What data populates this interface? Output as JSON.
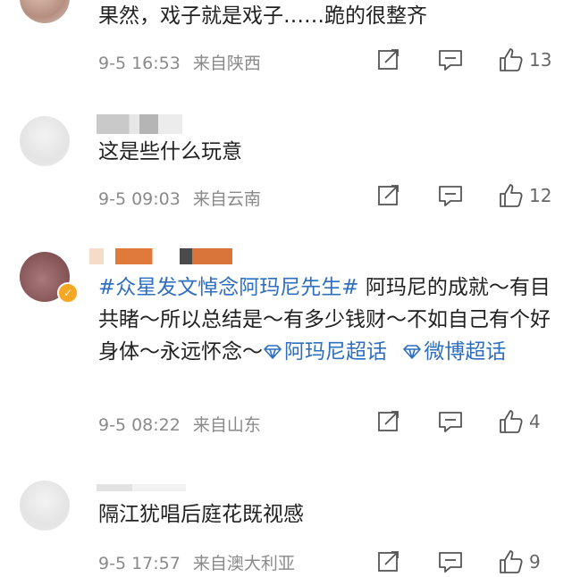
{
  "comments": [
    {
      "text": "果然，戏子就是戏子……跪的很整齐",
      "date": "9-5 16:53",
      "location": "来自陕西",
      "likes": "13"
    },
    {
      "text": "这是些什么玩意",
      "date": "9-5 09:03",
      "location": "来自云南",
      "likes": "12"
    },
    {
      "tag": "#众星发文悼念阿玛尼先生#",
      "text": " 阿玛尼的成就～有目共睹～所以总结是～有多少钱财～不如自己有个好身体～永远怀念～",
      "supertopic1": "阿玛尼超话",
      "supertopic2": "微博超话",
      "date": "9-5 08:22",
      "location": "来自山东",
      "likes": "4"
    },
    {
      "text": "隔江犹唱后庭花既视感",
      "date": "9-5 17:57",
      "location": "来自澳大利亚",
      "likes": "9"
    }
  ],
  "icons": {
    "share": "share-icon",
    "comment": "comment-icon",
    "like": "thumbs-up-icon",
    "diamond": "diamond-icon",
    "verified": "verified-badge-icon"
  },
  "colors": {
    "topic_link": "#2f6fbf",
    "meta_text": "#8a8a8a",
    "verified_badge": "#f5a623"
  }
}
